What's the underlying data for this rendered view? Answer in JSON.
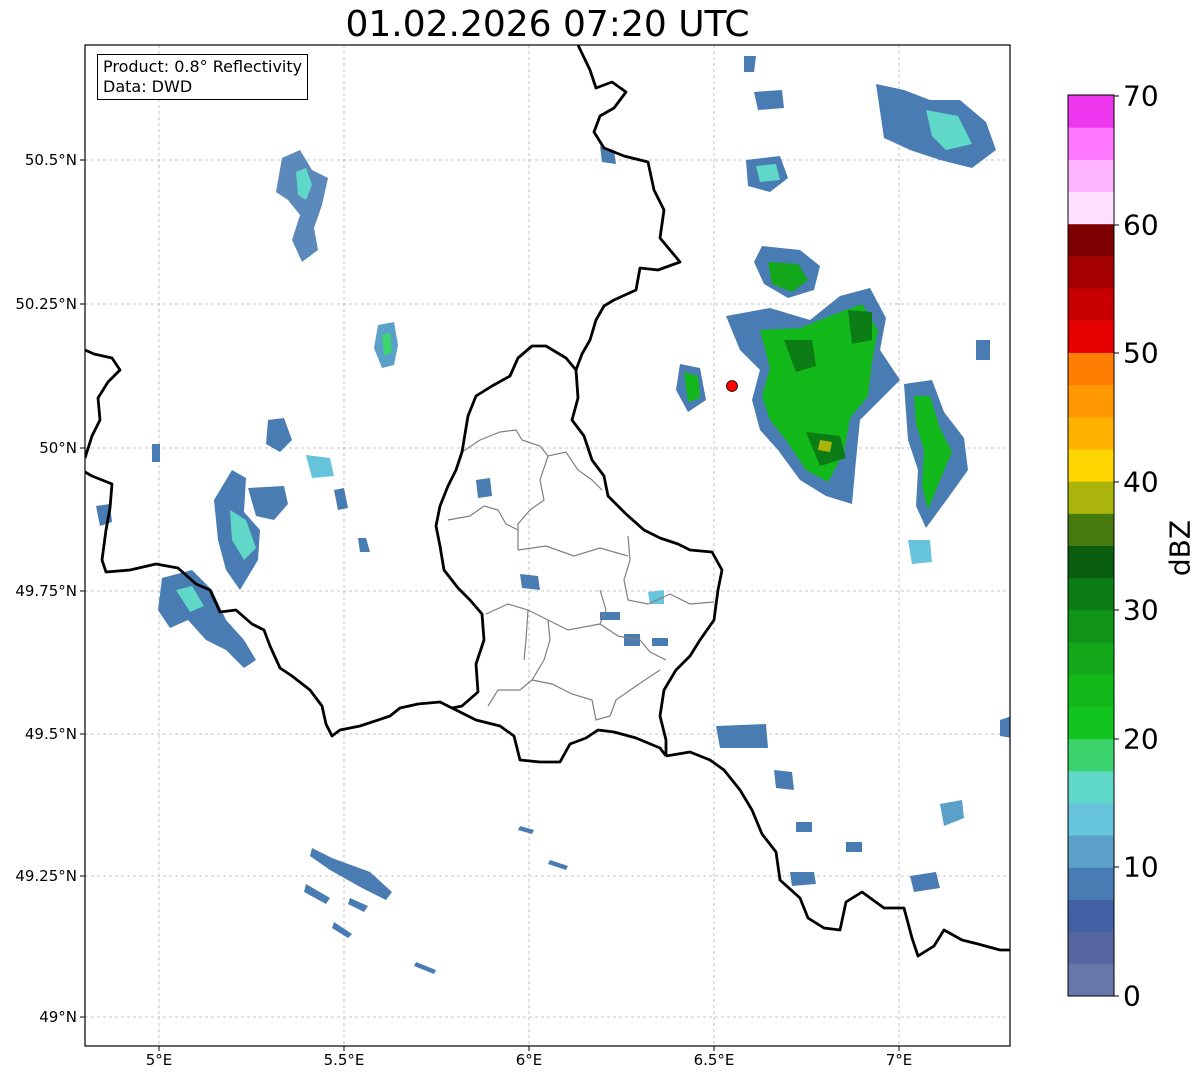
{
  "title": "01.02.2026 07:20 UTC",
  "info_box": {
    "product": "Product: 0.8° Reflectivity",
    "source": "Data: DWD"
  },
  "axes": {
    "lat_ticks": [
      "50.5°N",
      "50.25°N",
      "50°N",
      "49.75°N",
      "49.5°N",
      "49.25°N",
      "49°N"
    ],
    "lon_ticks": [
      "5°E",
      "5.5°E",
      "6°E",
      "6.5°E",
      "7°E"
    ],
    "lat_range": [
      48.95,
      50.7
    ],
    "lon_range": [
      4.8,
      7.3
    ],
    "grid": true
  },
  "marker": {
    "lat": 50.11,
    "lon": 6.55,
    "color": "#ff0000"
  },
  "colorbar": {
    "unit": "dBZ",
    "tick_labels": [
      "0",
      "10",
      "20",
      "30",
      "40",
      "50",
      "60",
      "70"
    ],
    "range": [
      0,
      70
    ],
    "colors": [
      "#6677aa",
      "#5566a0",
      "#4460a5",
      "#4a7cb4",
      "#5aa0c8",
      "#66c4dc",
      "#5fd8c8",
      "#3cd46c",
      "#11c41e",
      "#13b81a",
      "#12a81a",
      "#0f9418",
      "#0c7c14",
      "#0a5e10",
      "#467a0e",
      "#aab40a",
      "#ffd700",
      "#ffb300",
      "#ff9800",
      "#ff7d00",
      "#e60000",
      "#c80000",
      "#a50000",
      "#7d0000",
      "#ffe0ff",
      "#ffb4ff",
      "#ff78ff",
      "#ee36ee"
    ]
  },
  "colors": {
    "border_national": "#000000",
    "border_regional": "#808080",
    "grid": "#b4b4b4"
  }
}
